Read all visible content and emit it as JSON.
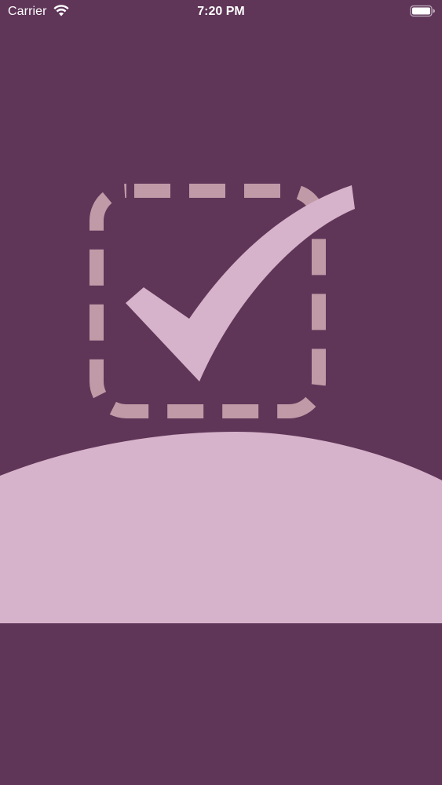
{
  "status_bar": {
    "carrier": "Carrier",
    "time": "7:20 PM",
    "wifi_icon": "wifi-icon",
    "battery_icon": "battery-icon"
  },
  "splash": {
    "logo_icon": "dashed-checkbox-checkmark-icon",
    "colors": {
      "background": "#5f3558",
      "dashed_box": "#c09aa6",
      "checkmark": "#d6b3ca",
      "hill": "#d6b3ca"
    }
  }
}
